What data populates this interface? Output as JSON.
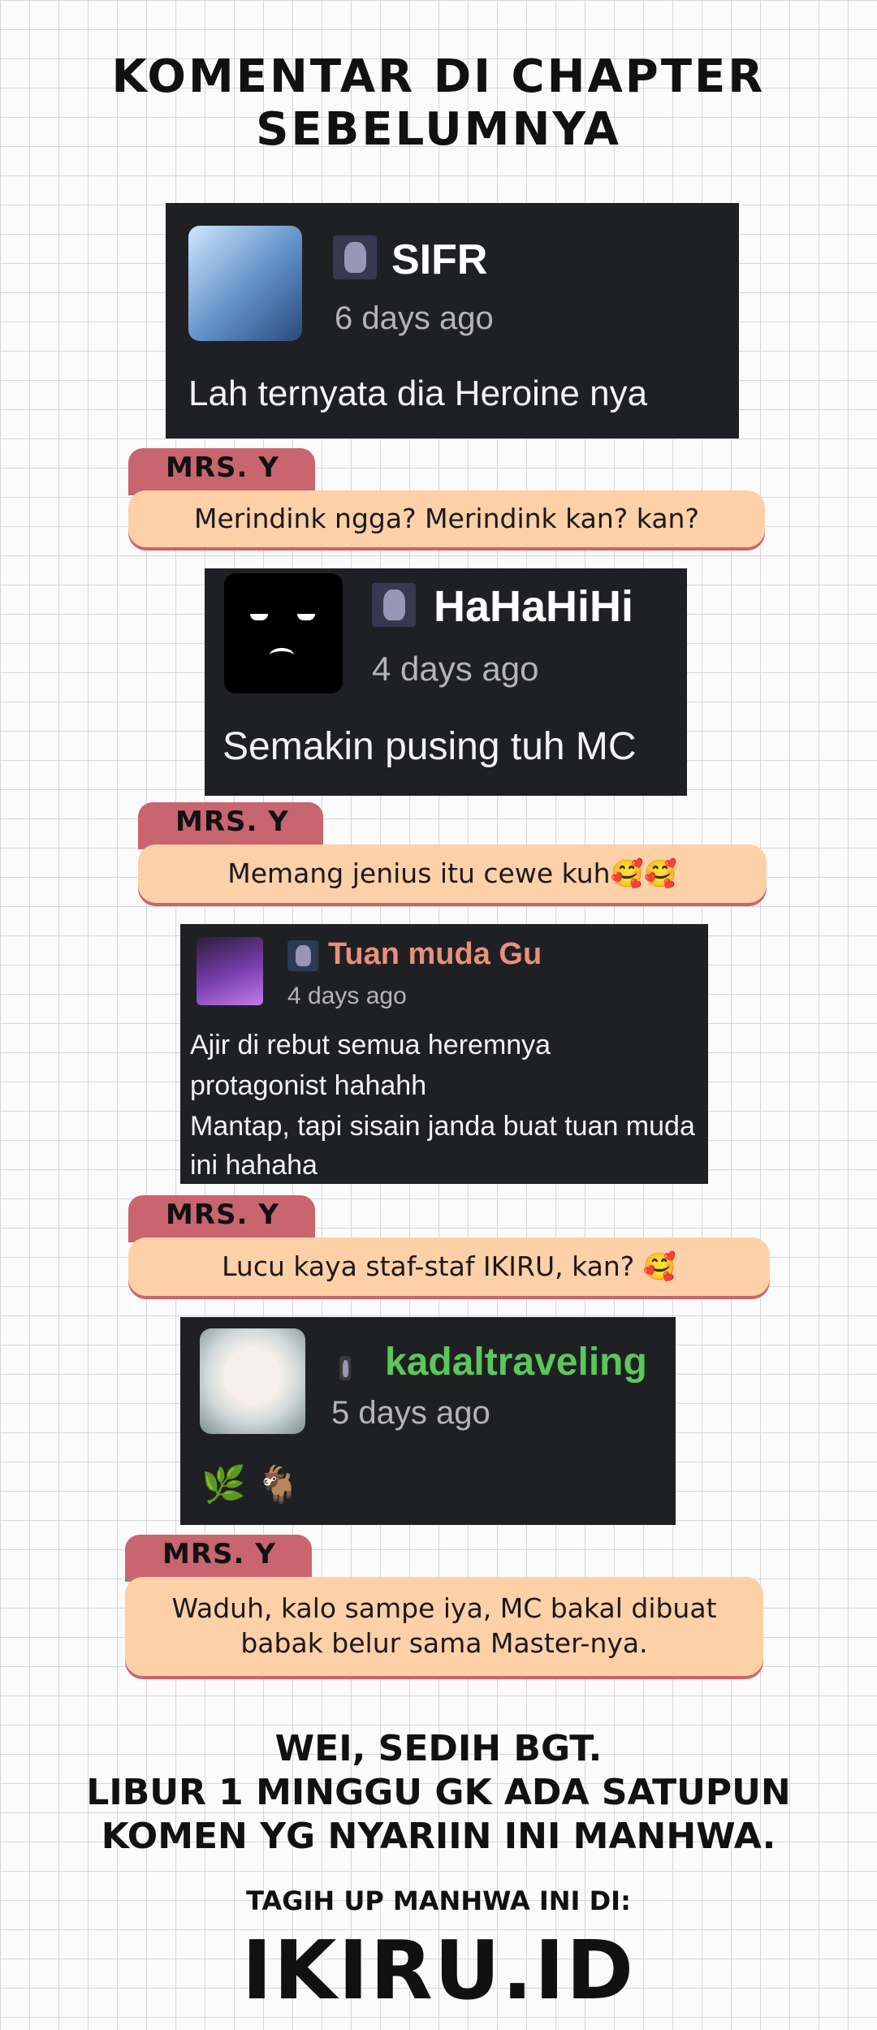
{
  "page": {
    "title": "KOMENTAR DI CHAPTER SEBELUMNYA"
  },
  "threads": [
    {
      "comment": {
        "username": "SIFR",
        "time": "6 days ago",
        "text": "Lah ternyata dia Heroine nya"
      },
      "reply": {
        "author": "MRS. Y",
        "text": "Merindink ngga? Merindink kan? kan?"
      }
    },
    {
      "comment": {
        "username": "HaHaHiHi",
        "time": "4 days ago",
        "text": "Semakin pusing tuh MC"
      },
      "reply": {
        "author": "MRS. Y",
        "text": "Memang jenius itu cewe kuh🥰🥰"
      }
    },
    {
      "comment": {
        "username": "Tuan muda Gu",
        "time": "4 days ago",
        "lines": [
          "Ajir di rebut semua heremnya",
          "protagonist hahahh",
          "Mantap, tapi sisain janda buat tuan muda",
          "ini hahaha"
        ]
      },
      "reply": {
        "author": "MRS. Y",
        "text": "Lucu kaya staf-staf IKIRU, kan? 🥰"
      }
    },
    {
      "comment": {
        "username": "kadaltraveling",
        "time": "5 days ago",
        "text": "🌿 🐐"
      },
      "reply": {
        "author": "MRS. Y",
        "lines": [
          "Waduh, kalo sampe iya, MC bakal dibuat",
          "babak belur sama Master-nya."
        ]
      }
    }
  ],
  "footer": {
    "lines": [
      "WEI, SEDIH BGT.",
      "LIBUR 1 MINGGU GK ADA SATUPUN",
      "KOMEN YG NYARIIN INI MANHWA."
    ],
    "tagline": "TAGIH UP MANHWA INI DI:",
    "brand": "IKIRU.ID"
  },
  "colors": {
    "card_bg": "#1f2024",
    "reply_tab": "#c8656f",
    "reply_bubble": "#fdd0a8",
    "username_accent_gu": "#e8907a",
    "username_accent_kadal": "#5ac85a"
  }
}
